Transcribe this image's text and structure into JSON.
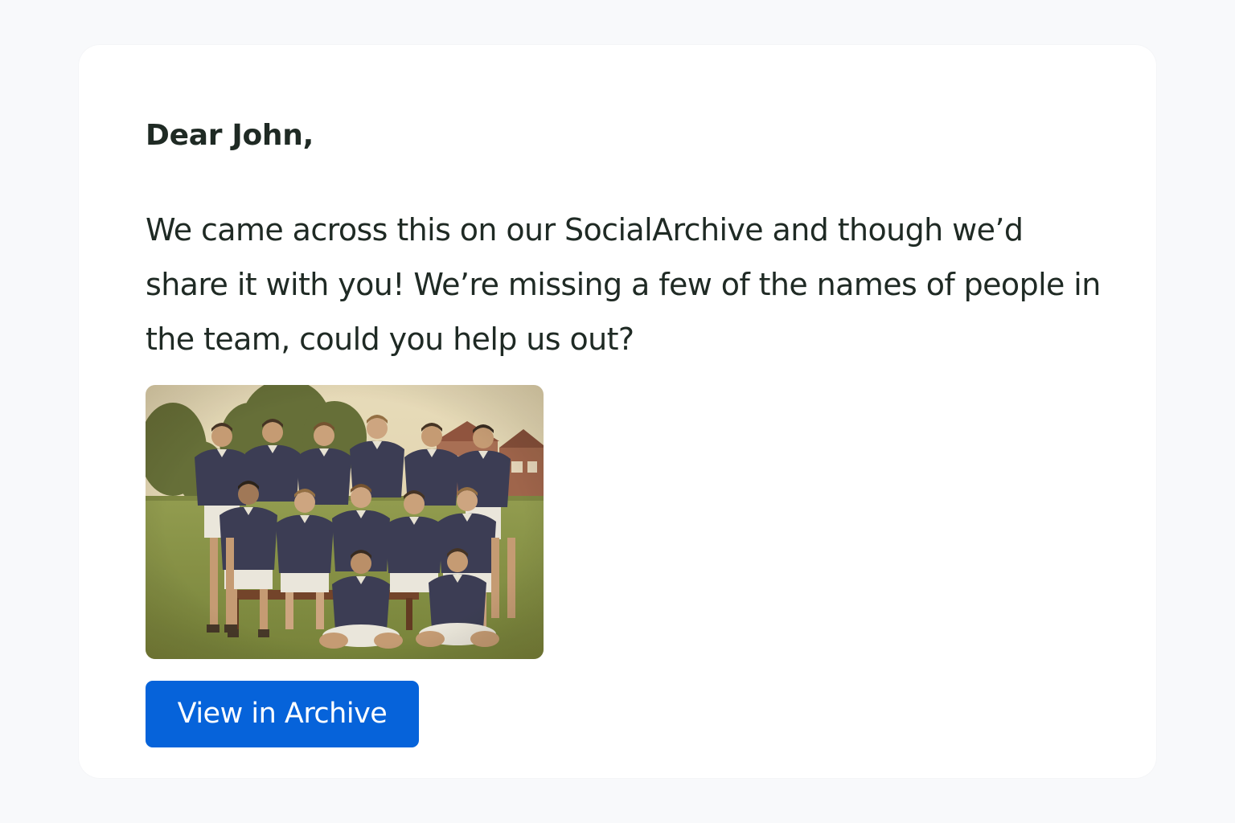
{
  "email": {
    "greeting": "Dear John,",
    "body": "We came across this on our SocialArchive and though we’d share it with you! We’re missing a few of the names of people in the team, could you help us out?",
    "photo": {
      "subject": "team-photo"
    },
    "button_label": "View in Archive"
  },
  "colors": {
    "page_background": "#f8f9fb",
    "card_background": "#ffffff",
    "text": "#1f2a24",
    "button": "#0663da",
    "button_text": "#ffffff"
  }
}
